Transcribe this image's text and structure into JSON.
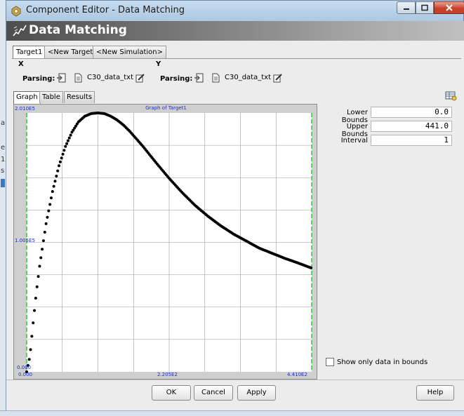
{
  "window": {
    "title": "Component Editor - Data Matching",
    "icons": {
      "app": "component-editor-icon",
      "minimize": "minimize-icon",
      "maximize": "maximize-icon",
      "close": "close-icon"
    }
  },
  "header": {
    "title": "Data Matching",
    "icon": "data-matching-icon"
  },
  "top_tabs": [
    {
      "label": "Target1",
      "active": true
    },
    {
      "label": "<New Target>",
      "active": false
    },
    {
      "label": "<New Simulation>",
      "active": false
    }
  ],
  "x_group": {
    "label": "X",
    "parsing_label": "Parsing:",
    "file": "C30_data_txt"
  },
  "y_group": {
    "label": "Y",
    "parsing_label": "Parsing:",
    "file": "C30_data_txt"
  },
  "inner_tabs": [
    {
      "label": "Graph",
      "active": true
    },
    {
      "label": "Table",
      "active": false
    },
    {
      "label": "Results",
      "active": false
    }
  ],
  "bounds": {
    "lower_label": "Lower Bounds",
    "lower_value": "0.0",
    "upper_label": "Upper Bounds",
    "upper_value": "441.0",
    "interval_label": "Interval",
    "interval_value": "1"
  },
  "checkbox": {
    "label": "Show only data in bounds",
    "checked": false
  },
  "buttons": {
    "ok": "OK",
    "cancel": "Cancel",
    "apply": "Apply",
    "help": "Help"
  },
  "colors": {
    "axis_text": "#1b2ad6",
    "bound_marker": "#22cc22",
    "data_point": "#000000"
  },
  "chart_data": {
    "type": "scatter",
    "title": "Graph of Target1",
    "x_ticks": [
      "0.000",
      "2.205E2",
      "4.410E2"
    ],
    "y_ticks": [
      "0.000",
      "1.005E5",
      "2.010E5"
    ],
    "xlim": [
      0,
      441
    ],
    "ylim": [
      0,
      201000
    ],
    "bounds_markers": [
      0,
      441
    ],
    "grid": true,
    "series": [
      {
        "x": [
          0,
          2,
          5,
          10,
          15,
          20,
          30,
          40,
          50,
          60,
          70,
          80,
          90,
          100,
          110,
          120,
          130,
          140,
          150,
          160,
          180,
          200,
          220,
          240,
          260,
          280,
          300,
          320,
          340,
          360,
          380,
          400,
          420,
          441
        ],
        "y": [
          0,
          5000,
          12000,
          38000,
          62000,
          82000,
          115000,
          140000,
          160000,
          175000,
          186000,
          194000,
          198500,
          200500,
          201000,
          200500,
          198500,
          195500,
          191500,
          186500,
          175000,
          162500,
          150500,
          139500,
          129500,
          121000,
          113500,
          107000,
          101500,
          96000,
          92000,
          88000,
          84500,
          80500
        ]
      }
    ]
  }
}
